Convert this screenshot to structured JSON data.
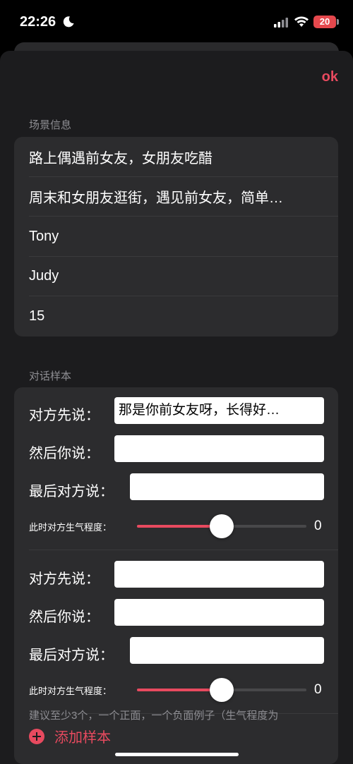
{
  "status_bar": {
    "time": "22:26",
    "moon_icon": "moon-icon",
    "signal_icon": "signal-icon",
    "wifi_icon": "wifi-icon",
    "battery_level": "20",
    "battery_color": "#e5484d"
  },
  "toolbar": {
    "ok_label": "ok"
  },
  "scene": {
    "header": "场景信息",
    "rows": [
      "路上偶遇前女友，女朋友吃醋",
      "周末和女朋友逛街，遇见前女友，简单…",
      "Tony",
      "Judy",
      "15"
    ]
  },
  "dialog": {
    "header": "对话样本",
    "samples": [
      {
        "opponent_first_label": "对方先说：",
        "opponent_first_value": "那是你前女友呀，长得好…",
        "you_say_label": "然后你说：",
        "you_say_value": "",
        "opponent_last_label": "最后对方说：",
        "opponent_last_value": "",
        "anger_label": "此时对方生气程度：",
        "anger_value": "0",
        "anger_slider_fraction": 0.5
      },
      {
        "opponent_first_label": "对方先说：",
        "opponent_first_value": "",
        "you_say_label": "然后你说：",
        "you_say_value": "",
        "opponent_last_label": "最后对方说：",
        "opponent_last_value": "",
        "anger_label": "此时对方生气程度：",
        "anger_value": "0",
        "anger_slider_fraction": 0.5
      }
    ],
    "add_sample_label": "添加样本",
    "add_icon": "plus-circle-icon"
  },
  "footer": {
    "note": "建议至少3个，一个正面，一个负面例子（生气程度为"
  },
  "colors": {
    "accent": "#e84a5f",
    "background": "#1c1c1e",
    "card": "#2c2c2e"
  }
}
